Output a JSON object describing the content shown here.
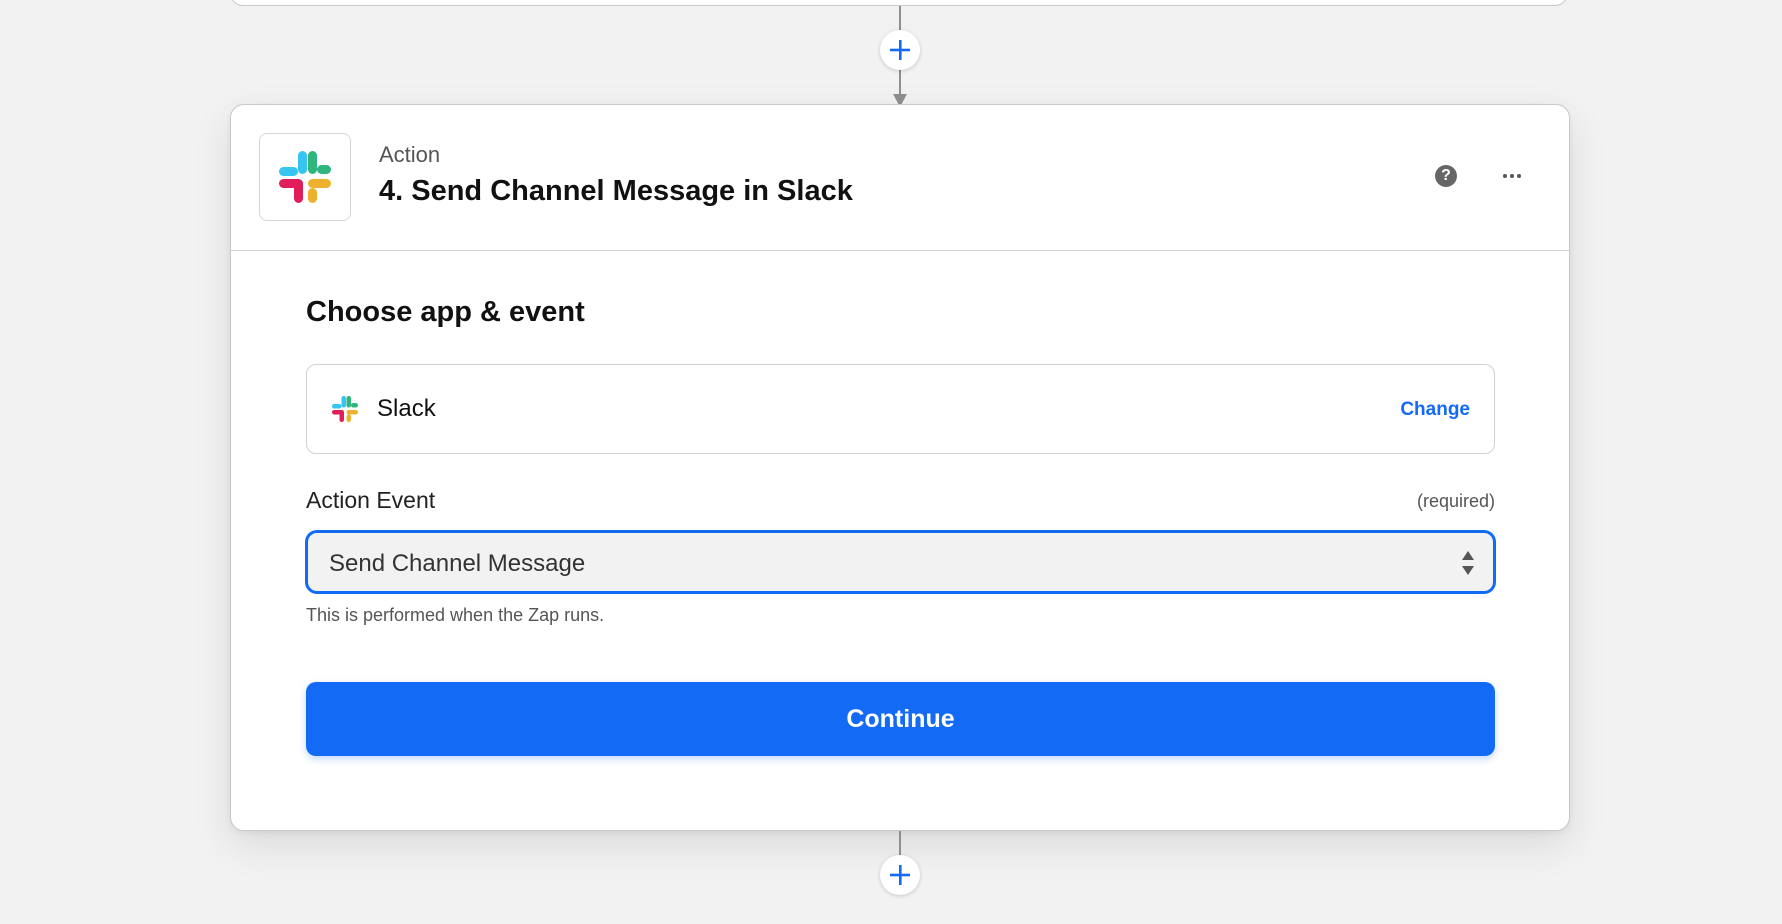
{
  "step": {
    "type_label": "Action",
    "title": "4. Send Channel Message in Slack",
    "help_icon": "question-circle-icon",
    "more_icon": "ellipsis-icon"
  },
  "section": {
    "title": "Choose app & event"
  },
  "app_selector": {
    "app_name": "Slack",
    "change_label": "Change",
    "icon": "slack-logo-icon"
  },
  "action_event": {
    "label": "Action Event",
    "required_label": "(required)",
    "selected_value": "Send Channel Message",
    "helper_text": "This is performed when the Zap runs."
  },
  "continue_button": {
    "label": "Continue"
  },
  "colors": {
    "primary_blue": "#136bf5",
    "background": "#f2f2f2",
    "connector": "#8f8f8f",
    "slack_blue": "#36c5f0",
    "slack_green": "#2eb67d",
    "slack_red": "#e01e5a",
    "slack_yellow": "#ecb22e"
  }
}
